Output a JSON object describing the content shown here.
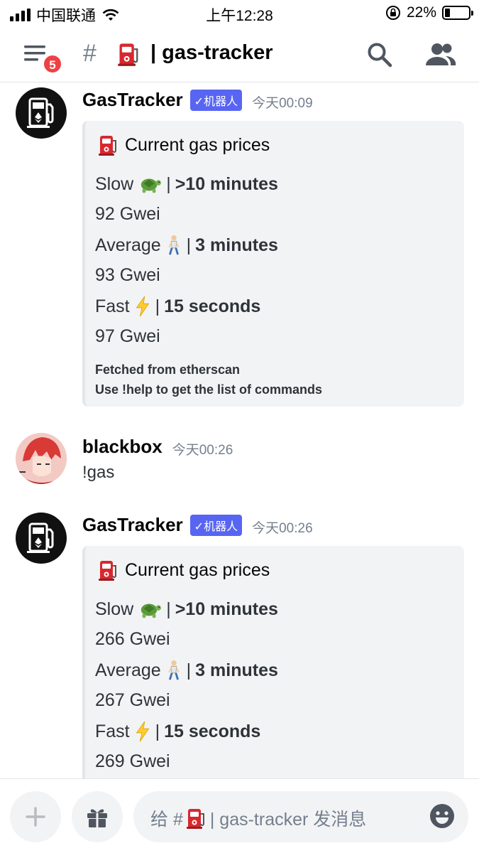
{
  "status_bar": {
    "carrier": "中国联通",
    "time": "上午12:28",
    "battery": "22%",
    "battery_level": 0.22
  },
  "header": {
    "notification_count": "5",
    "channel_hash": "#",
    "channel_name": "| gas-tracker"
  },
  "messages": [
    {
      "author": "GasTracker",
      "bot_tag": "✓机器人",
      "timestamp": "今天00:09",
      "embed": {
        "title": "Current gas prices",
        "slow_label": "Slow",
        "slow_time": ">10 minutes",
        "slow_price": "92 Gwei",
        "avg_label": "Average",
        "avg_time": "3 minutes",
        "avg_price": "93 Gwei",
        "fast_label": "Fast",
        "fast_time": "15 seconds",
        "fast_price": "97 Gwei",
        "footer_1": "Fetched from etherscan",
        "footer_2": "Use !help to get the list of commands"
      }
    },
    {
      "author": "blackbox",
      "timestamp": "今天00:26",
      "text": "!gas"
    },
    {
      "author": "GasTracker",
      "bot_tag": "✓机器人",
      "timestamp": "今天00:26",
      "embed": {
        "title": "Current gas prices",
        "slow_label": "Slow",
        "slow_time": ">10 minutes",
        "slow_price": "266 Gwei",
        "avg_label": "Average",
        "avg_time": "3 minutes",
        "avg_price": "267 Gwei",
        "fast_label": "Fast",
        "fast_time": "15 seconds",
        "fast_price": "269 Gwei"
      }
    }
  ],
  "input": {
    "placeholder_prefix": "给 #",
    "placeholder_suffix": "| gas-tracker 发消息"
  },
  "icons": {
    "menu": "menu-icon",
    "search": "search-icon",
    "members": "members-icon",
    "plus": "plus-icon",
    "gift": "gift-icon",
    "emoji": "emoji-icon",
    "fuel_pump": "fuel-pump-icon",
    "turtle": "turtle-emoji",
    "walking": "walking-person-emoji",
    "lightning": "lightning-emoji"
  },
  "colors": {
    "brand": "#5865f2",
    "badge": "#ed4245",
    "embed_bg": "#f2f3f5"
  }
}
